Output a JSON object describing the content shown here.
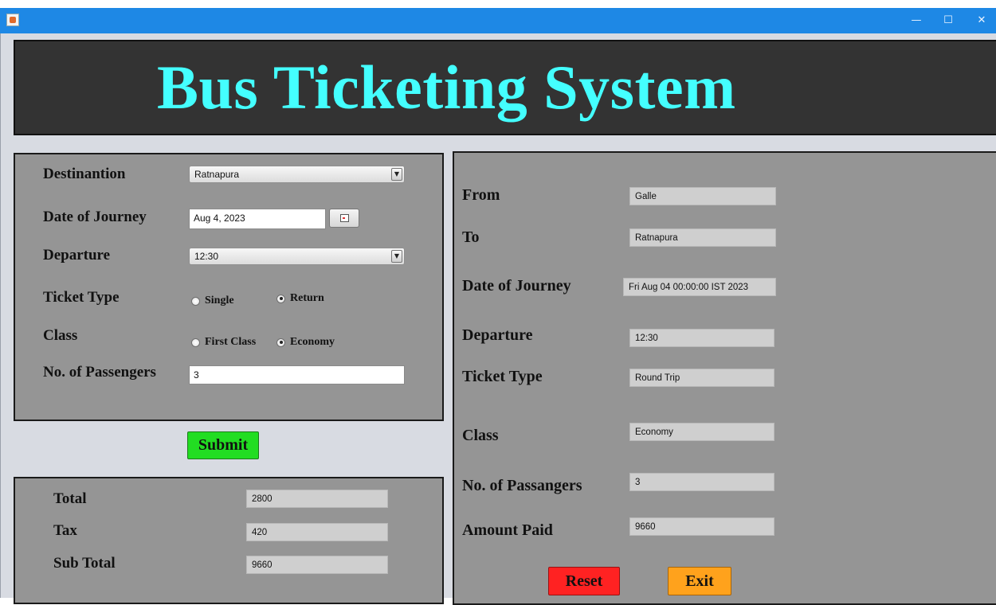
{
  "window": {
    "minimize_glyph": "—",
    "maximize_glyph": "☐",
    "close_glyph": "✕",
    "accent_color": "#1e88e5"
  },
  "header": {
    "title": "Bus Ticketing System",
    "title_color": "#44ffff"
  },
  "form": {
    "destination_label": "Destinantion",
    "destination_value": "Ratnapura",
    "date_label": "Date of Journey",
    "date_value": "Aug 4, 2023",
    "departure_label": "Departure",
    "departure_value": "12:30",
    "ticket_type_label": "Ticket Type",
    "ticket_type_options": [
      "Single",
      "Return"
    ],
    "ticket_type_selected": "Return",
    "class_label": "Class",
    "class_options": [
      "First Class",
      "Economy"
    ],
    "class_selected": "Economy",
    "passengers_label": "No. of Passengers",
    "passengers_value": "3",
    "submit_label": "Submit",
    "submit_color": "#22dd22"
  },
  "totals": {
    "total_label": "Total",
    "total_value": "2800",
    "tax_label": "Tax",
    "tax_value": "420",
    "subtotal_label": "Sub Total",
    "subtotal_value": "9660"
  },
  "summary": {
    "from_label": "From",
    "from_value": "Galle",
    "to_label": "To",
    "to_value": "Ratnapura",
    "date_label": "Date of Journey",
    "date_value": "Fri Aug 04 00:00:00 IST 2023",
    "departure_label": "Departure",
    "departure_value": "12:30",
    "ticket_type_label": "Ticket Type",
    "ticket_type_value": "Round Trip",
    "class_label": "Class",
    "class_value": "Economy",
    "passengers_label": "No. of Passangers",
    "passengers_value": "3",
    "amount_label": "Amount Paid",
    "amount_value": "9660",
    "reset_label": "Reset",
    "reset_color": "#ff2222",
    "exit_label": "Exit",
    "exit_color": "#ffa21c"
  }
}
